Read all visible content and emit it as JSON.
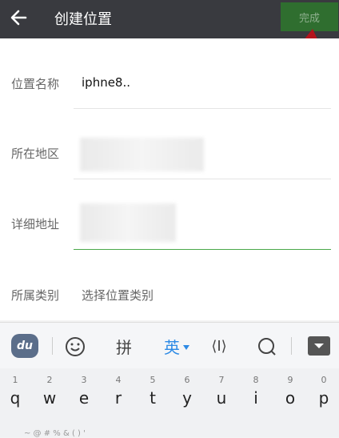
{
  "header": {
    "title": "创建位置",
    "done_label": "完成"
  },
  "form": {
    "fields": [
      {
        "label": "位置名称",
        "value": "iphne8.."
      },
      {
        "label": "所在地区",
        "value": ""
      },
      {
        "label": "详细地址",
        "value": ""
      },
      {
        "label": "所属类别",
        "placeholder": "选择位置类别"
      }
    ]
  },
  "keyboard": {
    "toolbar": {
      "logo": "du",
      "pinyin_label": "拼",
      "english_label": "英",
      "cursor_label": "⟨I⟩"
    },
    "keys": [
      {
        "num": "1",
        "ch": "q"
      },
      {
        "num": "2",
        "ch": "w"
      },
      {
        "num": "3",
        "ch": "e"
      },
      {
        "num": "4",
        "ch": "r"
      },
      {
        "num": "5",
        "ch": "t"
      },
      {
        "num": "6",
        "ch": "y"
      },
      {
        "num": "7",
        "ch": "u"
      },
      {
        "num": "8",
        "ch": "i"
      },
      {
        "num": "9",
        "ch": "o"
      },
      {
        "num": "0",
        "ch": "p"
      }
    ],
    "symbols": "~   @   #   %   &   (   )   '"
  },
  "colors": {
    "header_bg": "#393a3f",
    "done_bg": "#2f6e2f",
    "active_underline": "#4aa84a",
    "annotation_arrow": "#b3141c",
    "english_active": "#2d8ae5"
  }
}
